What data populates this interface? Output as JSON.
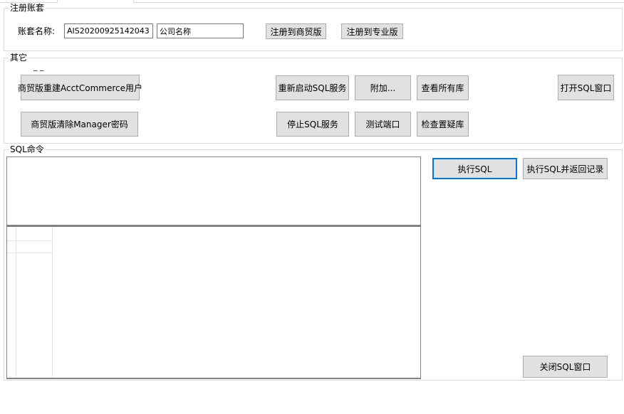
{
  "register_group": {
    "title": "注册账套",
    "account_label": "账套名称:",
    "account_value": "AIS20200925142043",
    "company_value": "公司名称",
    "btn_commerce": "注册到商贸版",
    "btn_pro": "注册到专业版"
  },
  "other_group": {
    "title": "其它",
    "marker": "_ _",
    "btn_rebuild_user": "商贸版重建AcctCommerce用户",
    "btn_clear_password": "商贸版清除Manager密码",
    "btn_restart_sql": "重新启动SQL服务",
    "btn_stop_sql": "停止SQL服务",
    "btn_attach": "附加...",
    "btn_test_port": "测试端口",
    "btn_view_dbs": "查看所有库",
    "btn_check_suspect": "检查置疑库",
    "btn_open_sql": "打开SQL窗口"
  },
  "sql_group": {
    "title": "SQL命令",
    "editor_value": "",
    "btn_execute": "执行SQL",
    "btn_execute_return": "执行SQL并返回记录",
    "btn_close": "关闭SQL窗口"
  }
}
